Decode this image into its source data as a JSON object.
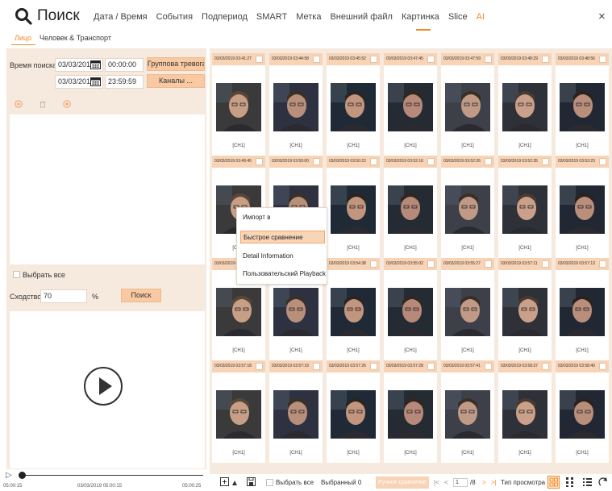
{
  "header": {
    "title": "Поиск",
    "tabs": [
      {
        "label": "Дата / Время",
        "active": false
      },
      {
        "label": "События",
        "active": false
      },
      {
        "label": "Подпериод",
        "active": false
      },
      {
        "label": "SMART",
        "active": false
      },
      {
        "label": "Метка",
        "active": false
      },
      {
        "label": "Внешний файл",
        "active": false
      },
      {
        "label": "Картинка",
        "active": false
      },
      {
        "label": "Slice",
        "active": false
      },
      {
        "label": "AI",
        "active": true
      }
    ],
    "close": "×"
  },
  "subtabs": [
    {
      "label": "Лицо",
      "active": true
    },
    {
      "label": "Человек & Транспорт",
      "active": false
    }
  ],
  "left": {
    "search_time_label": "Время поиска",
    "start_date": "03/03/2019",
    "start_time": "00:00:00",
    "end_date": "03/03/2019",
    "end_time": "23:59:59",
    "group_button": "Группова тревога ...",
    "channels_button": "Каналы ...",
    "select_all_label": "Выбрать все",
    "similarity_label": "Сходство",
    "similarity_value": "70",
    "similarity_unit": "%",
    "search_button": "Поиск"
  },
  "timeline": {
    "start": "05:00:15",
    "current": "03/03/2019 05:00:15",
    "end": "05:00:25"
  },
  "cards": [
    {
      "time": "03/03/2019 03:41:27",
      "channel": "[CH1]"
    },
    {
      "time": "03/03/2019 03:44:58",
      "channel": "[CH1]"
    },
    {
      "time": "03/03/2019 03:45:52",
      "channel": "[CH1]"
    },
    {
      "time": "03/03/2019 03:47:45",
      "channel": "[CH1]"
    },
    {
      "time": "03/03/2019 03:47:59",
      "channel": "[CH1]"
    },
    {
      "time": "03/03/2019 03:48:29",
      "channel": "[CH1]"
    },
    {
      "time": "03/03/2019 03:48:56",
      "channel": "[CH1]"
    },
    {
      "time": "03/03/2019 03:49:45",
      "channel": "[CH1]"
    },
    {
      "time": "03/03/2019 03:50:00",
      "channel": "[CH1]"
    },
    {
      "time": "03/03/2019 03:50:22",
      "channel": "[CH1]"
    },
    {
      "time": "03/03/2019 03:52:16",
      "channel": "[CH1]"
    },
    {
      "time": "03/03/2019 03:52:26",
      "channel": "[CH1]"
    },
    {
      "time": "03/03/2019 03:52:35",
      "channel": "[CH1]"
    },
    {
      "time": "03/03/2019 03:53:23",
      "channel": "[CH1]"
    },
    {
      "time": "03/03/2019 03:54:30",
      "channel": "[CH1]"
    },
    {
      "time": "03/03/2019 03:54:33",
      "channel": "[CH1]"
    },
    {
      "time": "03/03/2019 03:54:38",
      "channel": "[CH1]"
    },
    {
      "time": "03/03/2019 03:55:02",
      "channel": "[CH1]"
    },
    {
      "time": "03/03/2019 03:55:27",
      "channel": "[CH1]"
    },
    {
      "time": "03/03/2019 03:57:11",
      "channel": "[CH1]"
    },
    {
      "time": "03/03/2019 03:57:13",
      "channel": "[CH1]"
    },
    {
      "time": "03/03/2019 03:57:18",
      "channel": "[CH1]"
    },
    {
      "time": "03/03/2019 03:57:19",
      "channel": "[CH1]"
    },
    {
      "time": "03/03/2019 03:57:26",
      "channel": "[CH1]"
    },
    {
      "time": "03/03/2019 03:57:28",
      "channel": "[CH1]"
    },
    {
      "time": "03/03/2019 03:57:41",
      "channel": "[CH1]"
    },
    {
      "time": "03/03/2019 03:58:37",
      "channel": "[CH1]"
    },
    {
      "time": "03/03/2019 03:58:40",
      "channel": "[CH1]"
    }
  ],
  "context_menu": {
    "items": [
      {
        "label": "Импорт в",
        "selected": false
      },
      {
        "label": "Быстрое сравнение",
        "selected": true
      },
      {
        "label": "Detail Information",
        "selected": false
      },
      {
        "label": "Пользовательский Playback",
        "selected": false
      }
    ]
  },
  "bottom": {
    "select_all": "Выбрать все",
    "selected": "Выбранный 0",
    "manual_compare": "Ручное сравнение",
    "page_current": "1",
    "page_total": "/8",
    "view_type": "Тип просмотра"
  },
  "colors": {
    "accent": "#f28c28",
    "panel_bg": "#f6e9dd",
    "button_bg": "#f8c9a3"
  }
}
